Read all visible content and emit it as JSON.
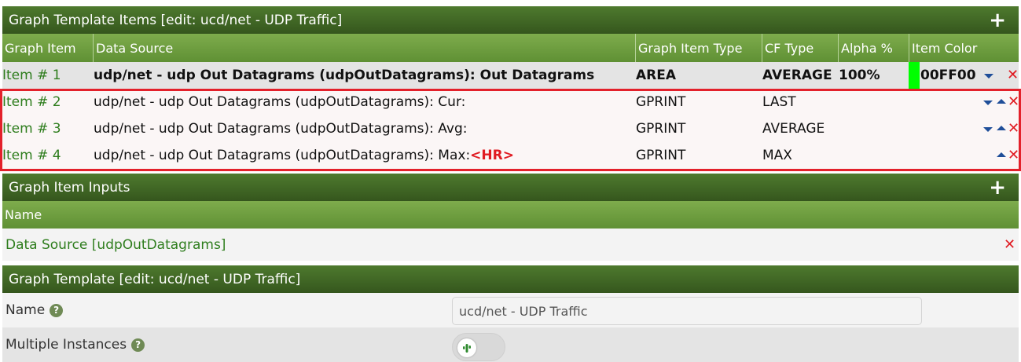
{
  "items_panel": {
    "title": "Graph Template Items [edit: ucd/net - UDP Traffic]",
    "add_icon": "plus-icon",
    "columns": [
      "Graph Item",
      "Data Source",
      "Graph Item Type",
      "CF Type",
      "Alpha %",
      "Item Color"
    ],
    "rows": [
      {
        "item": "Item # 1",
        "source": "udp/net - udp Out Datagrams (udpOutDatagrams): Out Datagrams",
        "type": "AREA",
        "cf": "AVERAGE",
        "alpha": "100%",
        "color_hex": "00FF00",
        "color": "#00ff00"
      },
      {
        "item": "Item # 2",
        "source": "udp/net - udp Out Datagrams (udpOutDatagrams): Cur:",
        "type": "GPRINT",
        "cf": "LAST",
        "alpha": "",
        "color_hex": ""
      },
      {
        "item": "Item # 3",
        "source": "udp/net - udp Out Datagrams (udpOutDatagrams): Avg:",
        "type": "GPRINT",
        "cf": "AVERAGE",
        "alpha": "",
        "color_hex": ""
      },
      {
        "item": "Item # 4",
        "source": "udp/net - udp Out Datagrams (udpOutDatagrams): Max:",
        "hr": "<HR>",
        "type": "GPRINT",
        "cf": "MAX",
        "alpha": "",
        "color_hex": ""
      }
    ]
  },
  "inputs_panel": {
    "title": "Graph Item Inputs",
    "add_icon": "plus-icon",
    "column": "Name",
    "row": "Data Source [udpOutDatagrams]"
  },
  "template_panel": {
    "title": "Graph Template [edit: ucd/net - UDP Traffic]",
    "name_label": "Name",
    "name_value": "ucd/net - UDP Traffic",
    "multiple_label": "Multiple Instances",
    "help_icon": "question-icon"
  },
  "colors": {
    "header_dark": "#35561d",
    "header_light": "#6e9e40",
    "link_green": "#2e7d1d",
    "delete_red": "#e01b22",
    "highlight_red": "#e3212b",
    "arrow_blue": "#1f4e99"
  }
}
